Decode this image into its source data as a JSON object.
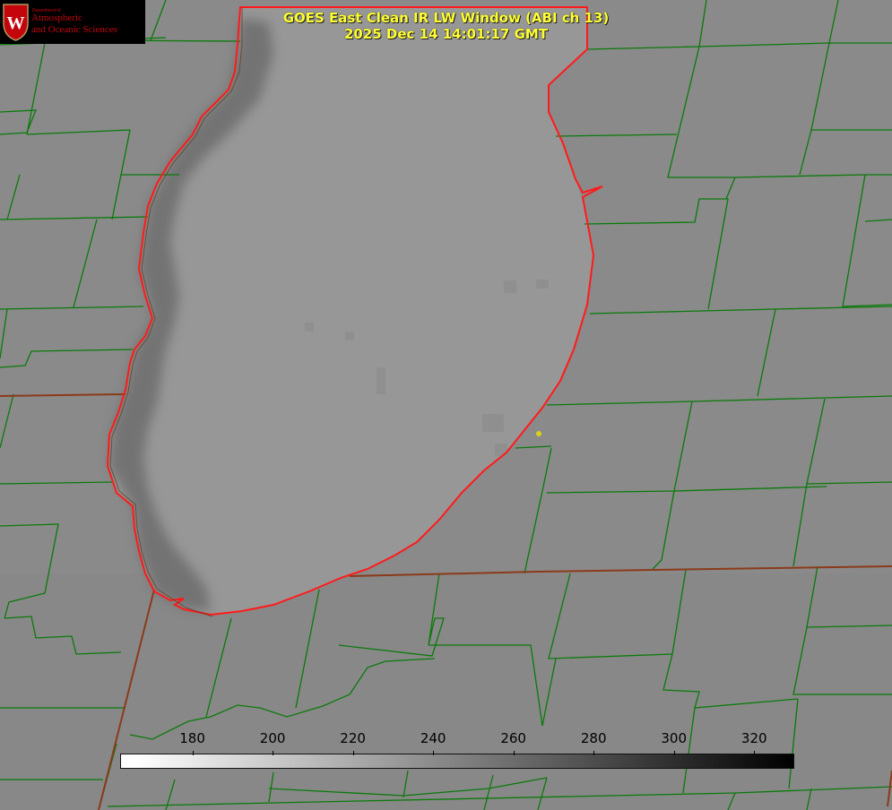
{
  "product": {
    "title_line1": "GOES East Clean IR LW Window (ABI ch 13)",
    "title_line2": "2025 Dec 14 14:01:17 GMT"
  },
  "logo": {
    "department": "Department of",
    "line1": "Atmospheric",
    "line2": "and Oceanic Sciences",
    "seal_letter": "W",
    "color": "#c5050c"
  },
  "colorbar": {
    "min": 162,
    "max": 330,
    "ticks": [
      "180",
      "200",
      "220",
      "240",
      "260",
      "280",
      "300",
      "320"
    ],
    "tick_values": [
      180,
      200,
      220,
      240,
      260,
      280,
      300,
      320
    ],
    "gradient": "white-to-black"
  },
  "map_colors": {
    "background": "#8a8a8a",
    "lake": "#979797",
    "lake_cold_edge": "#707070",
    "county_lines": "#0a7a0a",
    "coastline": "#ff1a1a",
    "state_lines": "#8b3a1a",
    "title_text": "#ffff33",
    "city_marker": "#d8d21a"
  }
}
